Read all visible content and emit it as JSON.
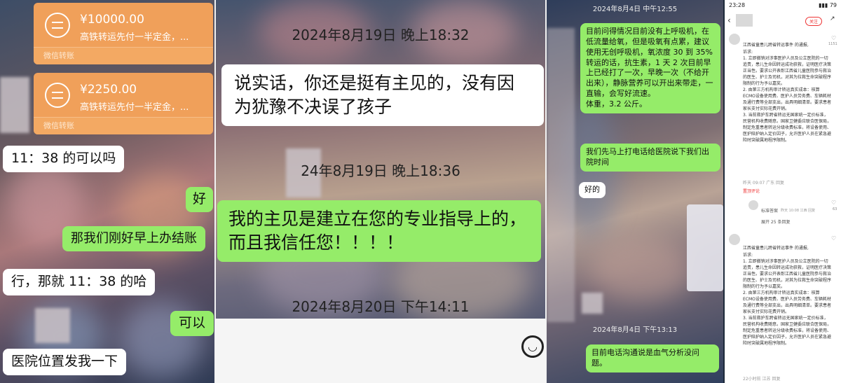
{
  "left_panel": {
    "transfers": [
      {
        "amount": "¥10000.00",
        "desc": "高铁转运先付一半定金，...",
        "footer": "微信转账"
      },
      {
        "amount": "¥2250.00",
        "desc": "高铁转运先付一半定金，...",
        "footer": "微信转账"
      }
    ],
    "messages": [
      {
        "side": "left",
        "text": "11：38 的可以吗"
      },
      {
        "side": "right",
        "text": "好"
      },
      {
        "side": "right",
        "text": "那我们刚好早上办结账"
      },
      {
        "side": "left",
        "text": "行，那就 11：38 的哈"
      },
      {
        "side": "right",
        "text": "可以"
      },
      {
        "side": "left",
        "text": "医院位置发我一下"
      }
    ]
  },
  "middle_panel": {
    "ts1": "2024年8月19日 晚上18:32",
    "msg1": "说实话，你还是挺有主见的，没有因为犹豫不决误了孩子",
    "ts2": "24年8月19日 晚上18:36",
    "msg2": "我的主见是建立在您的专业指导上的，而且我信任您！！！！",
    "ts3": "2024年8月20日 下午14:11"
  },
  "right_chat": {
    "ts1": "2024年8月4日 中午12:55",
    "msg1": "目前问得情况目前没有上呼吸机，在低流量给氧，但是吸氧有点累，建议使用无创呼吸机，氧浓度 30 到 35%\n转运的话，抗生素，1 天 2 次目前早上已经打了一次，早晚一次（不给开出来），静脉营养可以开出来带走，一直输，会写好流速。\n体重，3.2 公斤。",
    "msg2": "我们先马上打电话给医院说下我们出院时间",
    "msg3": "好的",
    "ts2": "2024年8月4日 下午13:13",
    "msg4": "目前电话沟通说是血气分析没问题。"
  },
  "phone": {
    "time": "23:28",
    "status_icons": "▮▮▮ 79",
    "follow_label": "关注",
    "post1_title": "江西省童患儿跨省转运事件 的通报,",
    "post1_body": "诉求:\n1. 立即撤销对涉事医护人员及公立医院的一切追责，患儿生命因转运成功获救，证明医疗决策正当性。要求公开表彰江西省儿童医院参与救治的医生、护士及司机，对其为拉救生命突破程序限制的行为予以嘉奖。\n2. 由第三方机构审计转运真实成本：核算ECMO设备使用费、医护人员劳务费、车辆耗材及通行费等全部支出，出具明细清单。要求患者家长支付实际花费开销。\n3. 当前救护车跨省转运无国家统一定价标准，民营机构收费随意。国家卫健委应联合医保局，制定危重患者转运分级收费标准，将设备使用、医护陪护纳入定价因子，允许医护人员在紧急避险时突破属地程序限制。",
    "post1_meta": "昨天 09:07 广东   回复",
    "reply_label": "置顶评论",
    "comment_name": "标准答案",
    "comment_meta": "昨天 10:08 江西  回复",
    "expand_label": "展开 25 条回复",
    "like1": "1151",
    "like2": "63",
    "post2_title": "江西省童患儿跨省转运事件 的通报,",
    "post2_body": "诉求:\n1. 立即撤销对涉事医护人员及公立医院的一切追责，患儿生命因转运成功获救，证明医疗决策正当性。要求公开表彰江西省儿童医院参与救治的医生、护士及司机，对其为拉救生命突破程序限制的行为予以嘉奖。\n2. 由第三方机构审计转运真实成本：核算ECMO设备使用费、医护人员劳务费、车辆耗材及通行费等全部支出，出具明细清单。要求患者家长支付实际花费开销。\n3. 当前救护车跨省转运无国家统一定价标准，民营机构收费随意。国家卫健委应联合医保局，制定危重患者转运分级收费标准，将设备使用、医护陪护纳入定价因子，允许医护人员在紧急避险时突破属地程序限制。",
    "post2_meta": "22小时前 江苏  回复"
  }
}
